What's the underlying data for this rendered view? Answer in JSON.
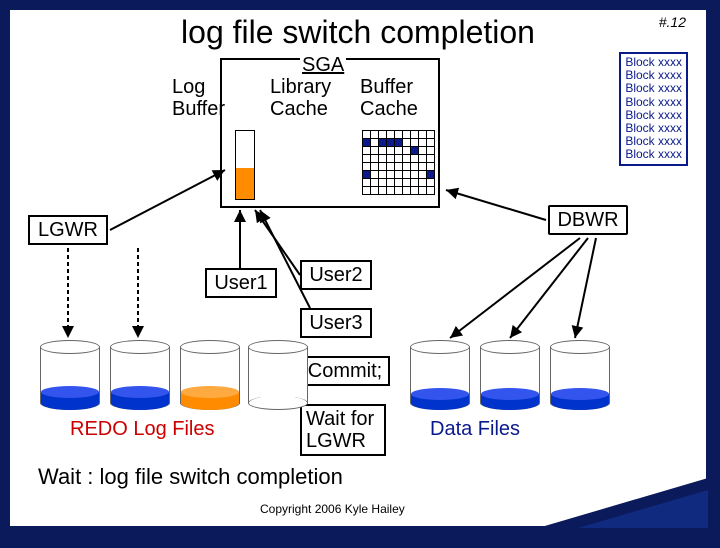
{
  "slide": {
    "number": "#.12",
    "title": "log file switch completion"
  },
  "sga": {
    "label": "SGA",
    "log_buffer": "Log\nBuffer",
    "library_cache": "Library\nCache",
    "buffer_cache": "Buffer\nCache"
  },
  "processes": {
    "lgwr": "LGWR",
    "dbwr": "DBWR"
  },
  "users": {
    "user1": "User1",
    "user2": "User2",
    "user3": "User3"
  },
  "actions": {
    "commit": "Commit;",
    "wait_lgwr": "Wait for\nLGWR"
  },
  "labels": {
    "redo": "REDO Log Files",
    "data_files": "Data Files",
    "wait_line": "Wait : log file switch completion"
  },
  "copyright": "Copyright 2006 Kyle Hailey",
  "block_items": [
    "Block xxxx",
    "Block xxxx",
    "Block xxxx",
    "Block xxxx",
    "Block xxxx",
    "Block xxxx",
    "Block xxxx",
    "Block xxxx"
  ],
  "chart_data": {
    "type": "diagram",
    "title": "log file switch completion",
    "components": [
      "SGA",
      "Log Buffer",
      "Library Cache",
      "Buffer Cache",
      "LGWR",
      "DBWR",
      "User1",
      "User2",
      "User3",
      "REDO Log Files",
      "Data Files"
    ],
    "redo_log_files_count": 4,
    "data_files_count": 3,
    "wait_event": "log file switch completion",
    "user_action_sequence": [
      "Commit;",
      "Wait for LGWR"
    ]
  }
}
